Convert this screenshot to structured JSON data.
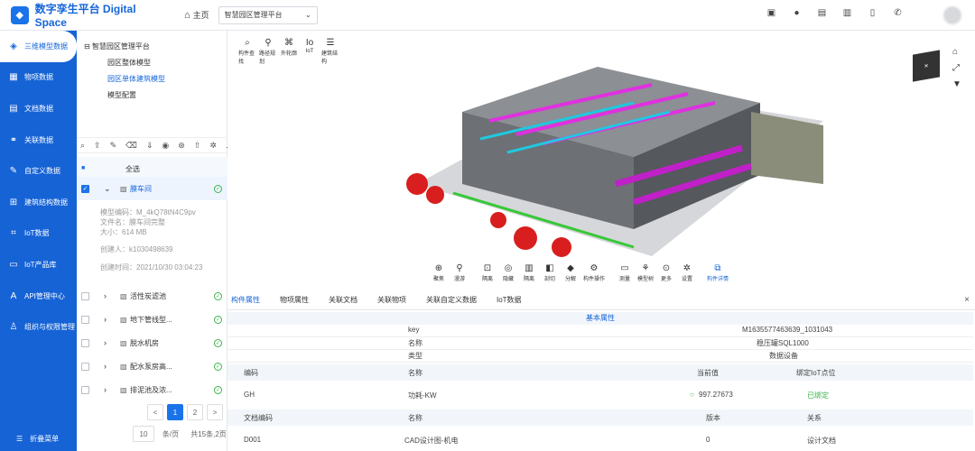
{
  "header": {
    "brand": "数字孪生平台 Digital Space",
    "home": "主页",
    "project_select": "智慧园区管理平台"
  },
  "sidebar": {
    "items": [
      {
        "label": "三维模型数据",
        "icon": "cube-icon",
        "active": true
      },
      {
        "label": "物项数据",
        "icon": "box-icon"
      },
      {
        "label": "文档数据",
        "icon": "document-icon"
      },
      {
        "label": "关联数据",
        "icon": "link-icon"
      },
      {
        "label": "自定义数据",
        "icon": "edit-icon"
      },
      {
        "label": "建筑结构数据",
        "icon": "structure-icon"
      },
      {
        "label": "IoT数据",
        "icon": "iot-icon"
      },
      {
        "label": "IoT产品库",
        "icon": "library-icon"
      },
      {
        "label": "API管理中心",
        "icon": "api-icon"
      },
      {
        "label": "组织与权限管理",
        "icon": "org-icon"
      }
    ],
    "collapse": "折叠菜单"
  },
  "tree": {
    "root": "智慧园区管理平台",
    "children": [
      "园区整体模型",
      "园区单体建筑模型",
      "模型配置"
    ],
    "select_all": "全选",
    "expanded": {
      "label": "膜车间",
      "model_code": "模型编码：M_4kQ78tN4C9pv",
      "file_name": "文件名：膜车间完整",
      "size": "大小：614 MB",
      "creator": "创建人：k1030498639",
      "created": "创建时间：2021/10/30 03:04:23"
    },
    "items": [
      "活性炭滤池",
      "地下管线型...",
      "脱水机房",
      "配水泵房高...",
      "排泥池及浓..."
    ],
    "pager": {
      "prev": "<",
      "p1": "1",
      "p2": "2",
      "next": ">",
      "size": "10",
      "per": "条/页",
      "total": "共15条,2页"
    }
  },
  "viewer": {
    "top_tools": [
      "构件查找",
      "路径规划",
      "外轮廓",
      "IoT",
      "建筑结构"
    ],
    "bottom_tools": [
      "聚焦",
      "漫游",
      "隔离",
      "隐藏",
      "隔离",
      "剖切",
      "分解",
      "构件操作",
      "测量",
      "模型树",
      "更多",
      "设置",
      "构件详情"
    ]
  },
  "tabs": [
    "构件属性",
    "物项属性",
    "关联文档",
    "关联物项",
    "关联自定义数据",
    "IoT数据"
  ],
  "props": {
    "section": "基本属性",
    "rows": [
      {
        "k": "key",
        "v": "M1635577463639_1031043"
      },
      {
        "k": "名称",
        "v": "稳压罐SQL1000"
      },
      {
        "k": "类型",
        "v": "数据设备"
      }
    ],
    "iot_head": [
      "编码",
      "名称",
      "当前值",
      "绑定IoT点位"
    ],
    "iot_row": [
      "GH",
      "功耗-KW",
      "997.27673",
      "已绑定"
    ],
    "doc_head": [
      "文档编码",
      "名称",
      "版本",
      "关系"
    ],
    "doc_row": [
      "D001",
      "CAD设计图-机电",
      "0",
      "设计文档"
    ]
  }
}
